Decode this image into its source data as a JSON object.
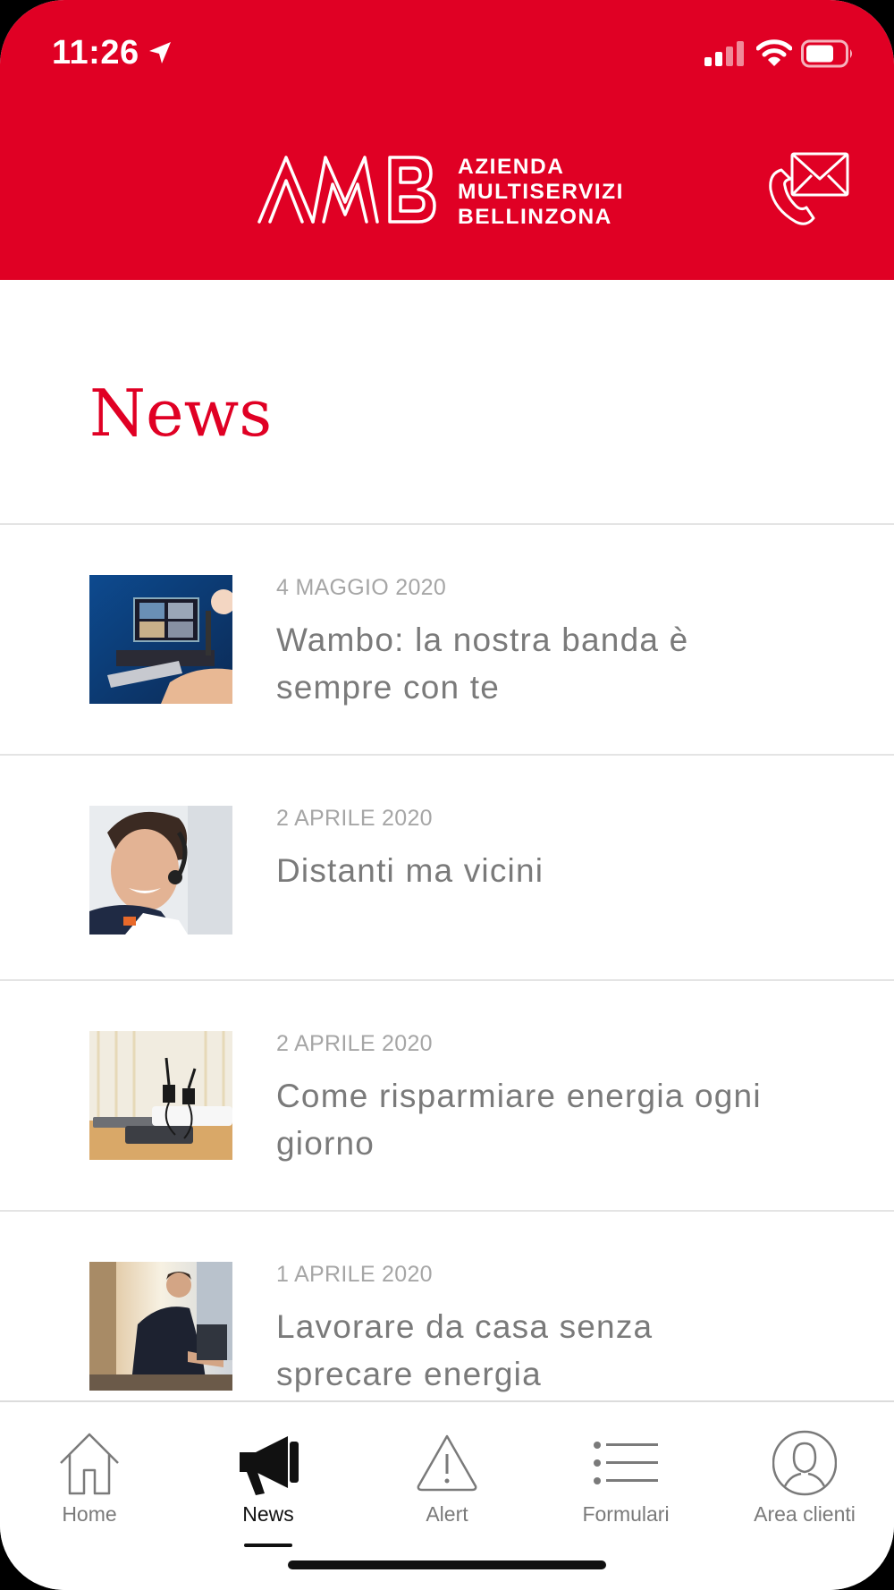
{
  "status_bar": {
    "time": "11:26"
  },
  "header": {
    "logo_text": "AMB",
    "company_name": [
      "AZIENDA",
      "MULTISERVIZI",
      "BELLINZONA"
    ],
    "contact_icon": "phone-mail-icon"
  },
  "page": {
    "title": "News"
  },
  "news": [
    {
      "date": "4 MAGGIO 2020",
      "title": "Wambo: la nostra banda è sempre con te",
      "thumbnail": "music-studio"
    },
    {
      "date": "2 APRILE 2020",
      "title": "Distanti ma vicini",
      "thumbnail": "support-agent"
    },
    {
      "date": "2 APRILE 2020",
      "title": "Come risparmiare energia ogni giorno",
      "thumbnail": "chargers"
    },
    {
      "date": "1 APRILE 2020",
      "title": "Lavorare da casa senza sprecare energia",
      "thumbnail": "home-office"
    }
  ],
  "tabbar": {
    "active": "News",
    "tabs": [
      {
        "label": "Home",
        "icon": "house-icon"
      },
      {
        "label": "News",
        "icon": "megaphone-icon"
      },
      {
        "label": "Alert",
        "icon": "warning-icon"
      },
      {
        "label": "Formulari",
        "icon": "list-icon"
      },
      {
        "label": "Area clienti",
        "icon": "user-icon"
      }
    ]
  },
  "colors": {
    "brand_red": "#e00024",
    "text_gray": "#7a7a7a",
    "date_gray": "#a6a6a6"
  }
}
